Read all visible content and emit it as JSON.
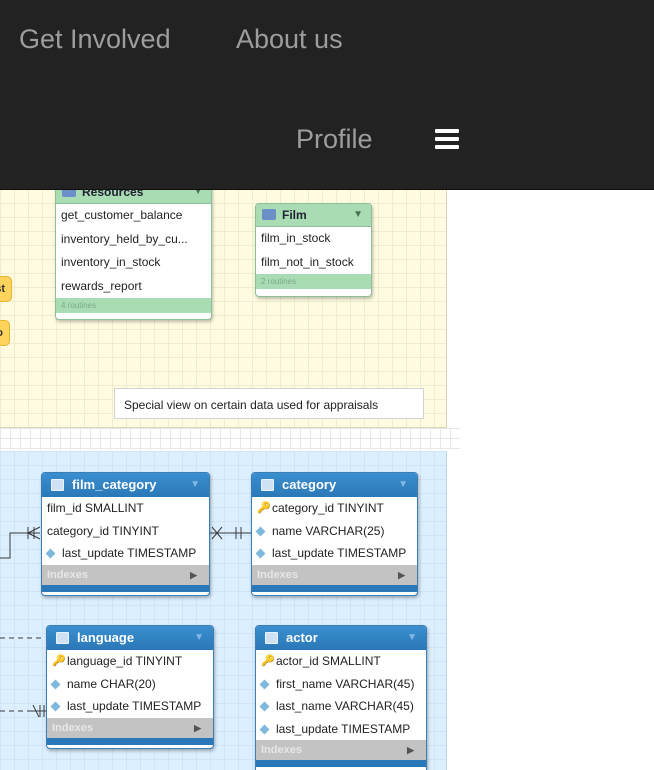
{
  "nav": {
    "get_involved": "Get Involved",
    "about_us": "About us",
    "profile": "Profile",
    "menu_icon": "hamburger-menu-icon"
  },
  "diagram": {
    "routine_groups": [
      {
        "title": "Resources",
        "items": [
          "get_customer_balance",
          "inventory_held_by_cu...",
          "inventory_in_stock",
          "rewards_report"
        ],
        "footer": "4 routines"
      },
      {
        "title": "Film",
        "items": [
          "film_in_stock",
          "film_not_in_stock"
        ],
        "footer": "2 routines"
      }
    ],
    "partial_labels": [
      "st",
      "fo"
    ],
    "note": "Special view on certain data used for appraisals",
    "tables": [
      {
        "name": "film_category",
        "columns": [
          {
            "key": "none",
            "text": "film_id SMALLINT"
          },
          {
            "key": "none",
            "text": "category_id TINYINT"
          },
          {
            "key": "diamond",
            "text": "last_update TIMESTAMP"
          }
        ],
        "indexes": "Indexes"
      },
      {
        "name": "category",
        "columns": [
          {
            "key": "pk",
            "text": "category_id TINYINT"
          },
          {
            "key": "diamond",
            "text": "name VARCHAR(25)"
          },
          {
            "key": "diamond",
            "text": "last_update TIMESTAMP"
          }
        ],
        "indexes": "Indexes"
      },
      {
        "name": "language",
        "columns": [
          {
            "key": "pk",
            "text": "language_id TINYINT"
          },
          {
            "key": "diamond",
            "text": "name CHAR(20)"
          },
          {
            "key": "diamond",
            "text": "last_update TIMESTAMP"
          }
        ],
        "indexes": "Indexes"
      },
      {
        "name": "actor",
        "columns": [
          {
            "key": "pk",
            "text": "actor_id SMALLINT"
          },
          {
            "key": "diamond",
            "text": "first_name VARCHAR(45)"
          },
          {
            "key": "diamond",
            "text": "last_name VARCHAR(45)"
          },
          {
            "key": "diamond",
            "text": "last_update TIMESTAMP"
          }
        ],
        "indexes": "Indexes"
      }
    ],
    "colors": {
      "nav_bg": "#222222",
      "nav_text": "#9d9d9d",
      "yellow_region": "#fffbe0",
      "blue_region": "#dcefff",
      "routine_green": "#a9dcb3",
      "table_header_blue": "#2b78b8",
      "indexes_gray": "#c3c3c3"
    }
  }
}
